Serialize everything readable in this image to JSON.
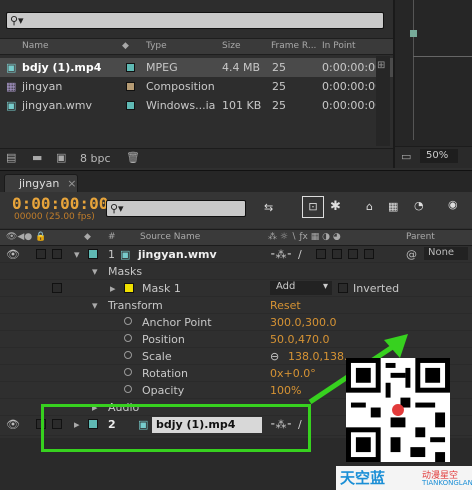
{
  "project": {
    "search_placeholder": "",
    "columns": {
      "name": "Name",
      "type": "Type",
      "size": "Size",
      "fps": "Frame R...",
      "inpoint": "In Point"
    },
    "items": [
      {
        "name": "bdjy (1).mp4",
        "color": "#5fb9b4",
        "type": "MPEG",
        "size": "4.4 MB",
        "fps": "25",
        "inpoint": "0:00:00:00",
        "selected": true
      },
      {
        "name": "jingyan",
        "color": "#b59b74",
        "type": "Composition",
        "size": "",
        "fps": "25",
        "inpoint": "0:00:00:00",
        "selected": false
      },
      {
        "name": "jingyan.wmv",
        "color": "#5fb9b4",
        "type": "Windows...ia",
        "size": "101 KB",
        "fps": "25",
        "inpoint": "0:00:00:00",
        "selected": false
      }
    ],
    "footer": {
      "bpc": "8 bpc"
    }
  },
  "viewer": {
    "zoom": "50%"
  },
  "timeline": {
    "tab": "jingyan",
    "timecode": "0:00:00:00",
    "timecode_sub": "00000 (25.00 fps)",
    "headers": {
      "num": "#",
      "source": "Source Name",
      "parent": "Parent"
    },
    "layer1": {
      "num": "1",
      "name": "jingyan.wmv",
      "parent": "None"
    },
    "masks_label": "Masks",
    "mask1": {
      "name": "Mask 1",
      "mode": "Add",
      "inverted": "Inverted"
    },
    "transform": {
      "label": "Transform",
      "reset": "Reset"
    },
    "props": [
      {
        "name": "Anchor Point",
        "value": "300.0,300.0"
      },
      {
        "name": "Position",
        "value": "50.0,470.0"
      },
      {
        "name": "Scale",
        "value": "138.0,138."
      },
      {
        "name": "Rotation",
        "value": "0x+0.0°"
      },
      {
        "name": "Opacity",
        "value": "100%"
      }
    ],
    "audio_label": "Audio",
    "layer2": {
      "num": "2",
      "name": "bdjy (1).mp4"
    }
  },
  "watermark": {
    "logo_text": "天空蓝",
    "logo_text2": "动漫星空",
    "logo_sub": "TIANKONGLAN"
  },
  "colors": {
    "accent": "#e7a43b",
    "highlight": "#37d11f",
    "panel": "#2d2d2d"
  }
}
